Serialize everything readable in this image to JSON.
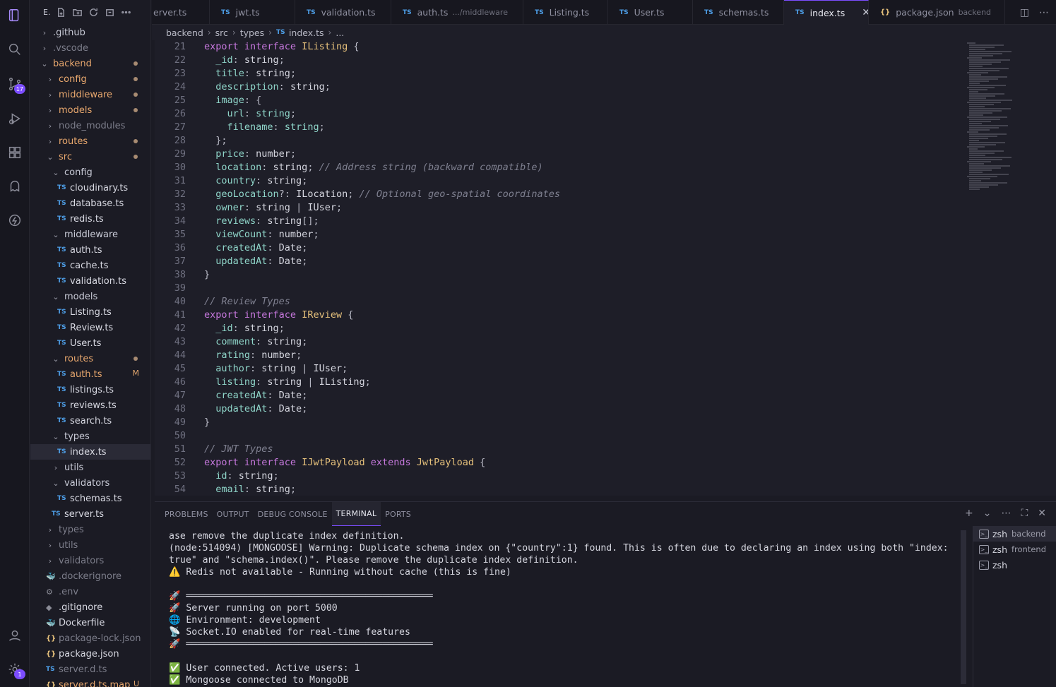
{
  "activity": {
    "source_control_badge": "17",
    "settings_badge": "1"
  },
  "sidebar": {
    "title": "E.",
    "tree": [
      {
        "label": ".github",
        "kind": "folder",
        "chev": "›",
        "indent": 0,
        "color": "folder"
      },
      {
        "label": ".vscode",
        "kind": "folder",
        "chev": "›",
        "indent": 0,
        "color": "dim"
      },
      {
        "label": "backend",
        "kind": "folder",
        "chev": "⌄",
        "indent": 0,
        "color": "orange",
        "dot": true
      },
      {
        "label": "config",
        "kind": "folder",
        "chev": "›",
        "indent": 1,
        "color": "orange",
        "dot": true
      },
      {
        "label": "middleware",
        "kind": "folder",
        "chev": "›",
        "indent": 1,
        "color": "orange",
        "dot": true
      },
      {
        "label": "models",
        "kind": "folder",
        "chev": "›",
        "indent": 1,
        "color": "orange",
        "dot": true
      },
      {
        "label": "node_modules",
        "kind": "folder",
        "chev": "›",
        "indent": 1,
        "color": "dim"
      },
      {
        "label": "routes",
        "kind": "folder",
        "chev": "›",
        "indent": 1,
        "color": "orange",
        "dot": true
      },
      {
        "label": "src",
        "kind": "folder",
        "chev": "⌄",
        "indent": 1,
        "color": "orange",
        "dot": true
      },
      {
        "label": "config",
        "kind": "folder",
        "chev": "⌄",
        "indent": 2,
        "color": "folder"
      },
      {
        "label": "cloudinary.ts",
        "kind": "ts",
        "indent": 3,
        "color": "file"
      },
      {
        "label": "database.ts",
        "kind": "ts",
        "indent": 3,
        "color": "file"
      },
      {
        "label": "redis.ts",
        "kind": "ts",
        "indent": 3,
        "color": "file"
      },
      {
        "label": "middleware",
        "kind": "folder",
        "chev": "⌄",
        "indent": 2,
        "color": "folder"
      },
      {
        "label": "auth.ts",
        "kind": "ts",
        "indent": 3,
        "color": "file"
      },
      {
        "label": "cache.ts",
        "kind": "ts",
        "indent": 3,
        "color": "file"
      },
      {
        "label": "validation.ts",
        "kind": "ts",
        "indent": 3,
        "color": "file"
      },
      {
        "label": "models",
        "kind": "folder",
        "chev": "⌄",
        "indent": 2,
        "color": "folder"
      },
      {
        "label": "Listing.ts",
        "kind": "ts",
        "indent": 3,
        "color": "file"
      },
      {
        "label": "Review.ts",
        "kind": "ts",
        "indent": 3,
        "color": "file"
      },
      {
        "label": "User.ts",
        "kind": "ts",
        "indent": 3,
        "color": "file"
      },
      {
        "label": "routes",
        "kind": "folder",
        "chev": "⌄",
        "indent": 2,
        "color": "orange",
        "dot": true
      },
      {
        "label": "auth.ts",
        "kind": "ts",
        "indent": 3,
        "color": "orange",
        "mod": "M"
      },
      {
        "label": "listings.ts",
        "kind": "ts",
        "indent": 3,
        "color": "file"
      },
      {
        "label": "reviews.ts",
        "kind": "ts",
        "indent": 3,
        "color": "file"
      },
      {
        "label": "search.ts",
        "kind": "ts",
        "indent": 3,
        "color": "file"
      },
      {
        "label": "types",
        "kind": "folder",
        "chev": "⌄",
        "indent": 2,
        "color": "folder"
      },
      {
        "label": "index.ts",
        "kind": "ts",
        "indent": 3,
        "color": "file",
        "selected": true
      },
      {
        "label": "utils",
        "kind": "folder",
        "chev": "›",
        "indent": 2,
        "color": "folder"
      },
      {
        "label": "validators",
        "kind": "folder",
        "chev": "⌄",
        "indent": 2,
        "color": "folder"
      },
      {
        "label": "schemas.ts",
        "kind": "ts",
        "indent": 3,
        "color": "file"
      },
      {
        "label": "server.ts",
        "kind": "ts",
        "indent": 2,
        "color": "file"
      },
      {
        "label": "types",
        "kind": "folder",
        "chev": "›",
        "indent": 1,
        "color": "dim"
      },
      {
        "label": "utils",
        "kind": "folder",
        "chev": "›",
        "indent": 1,
        "color": "dim"
      },
      {
        "label": "validators",
        "kind": "folder",
        "chev": "›",
        "indent": 1,
        "color": "dim"
      },
      {
        "label": ".dockerignore",
        "kind": "docker",
        "indent": 1,
        "color": "dim"
      },
      {
        "label": ".env",
        "kind": "gear",
        "indent": 1,
        "color": "dim"
      },
      {
        "label": ".gitignore",
        "kind": "misc",
        "indent": 1,
        "color": "file"
      },
      {
        "label": "Dockerfile",
        "kind": "docker",
        "indent": 1,
        "color": "file"
      },
      {
        "label": "package-lock.json",
        "kind": "json",
        "indent": 1,
        "color": "dim"
      },
      {
        "label": "package.json",
        "kind": "json",
        "indent": 1,
        "color": "file"
      },
      {
        "label": "server.d.ts",
        "kind": "ts",
        "indent": 1,
        "color": "dim"
      },
      {
        "label": "server.d.ts.map",
        "kind": "json",
        "indent": 1,
        "color": "orange",
        "mod": "U"
      }
    ]
  },
  "tabs": [
    {
      "label": "erver.ts",
      "icon": "none"
    },
    {
      "label": "jwt.ts",
      "icon": "ts"
    },
    {
      "label": "validation.ts",
      "icon": "ts"
    },
    {
      "label": "auth.ts",
      "icon": "ts",
      "desc": ".../middleware"
    },
    {
      "label": "Listing.ts",
      "icon": "ts"
    },
    {
      "label": "User.ts",
      "icon": "ts"
    },
    {
      "label": "schemas.ts",
      "icon": "ts"
    },
    {
      "label": "index.ts",
      "icon": "ts",
      "active": true
    },
    {
      "label": "package.json",
      "icon": "json",
      "desc": "backend"
    }
  ],
  "breadcrumb": {
    "seg1": "backend",
    "seg2": "src",
    "seg3": "types",
    "seg4": "index.ts",
    "seg5": "..."
  },
  "editor": {
    "lines": [
      {
        "n": "21",
        "tokens": [
          [
            "k",
            "export "
          ],
          [
            "k",
            "interface "
          ],
          [
            "t",
            "IListing "
          ],
          [
            "pu",
            "{"
          ]
        ]
      },
      {
        "n": "22",
        "tokens": [
          [
            "p",
            "  _id"
          ],
          [
            "pu",
            ": "
          ],
          [
            "ty",
            "string"
          ],
          [
            "pu",
            ";"
          ]
        ]
      },
      {
        "n": "23",
        "tokens": [
          [
            "p",
            "  title"
          ],
          [
            "pu",
            ": "
          ],
          [
            "ty",
            "string"
          ],
          [
            "pu",
            ";"
          ]
        ]
      },
      {
        "n": "24",
        "tokens": [
          [
            "p",
            "  description"
          ],
          [
            "pu",
            ": "
          ],
          [
            "ty",
            "string"
          ],
          [
            "pu",
            ";"
          ]
        ]
      },
      {
        "n": "25",
        "tokens": [
          [
            "p",
            "  image"
          ],
          [
            "pu",
            ": {"
          ]
        ]
      },
      {
        "n": "26",
        "tokens": [
          [
            "p",
            "    url"
          ],
          [
            "pu",
            ": "
          ],
          [
            "p",
            "string"
          ],
          [
            "pu",
            ";"
          ]
        ]
      },
      {
        "n": "27",
        "tokens": [
          [
            "p",
            "    filename"
          ],
          [
            "pu",
            ": "
          ],
          [
            "p",
            "string"
          ],
          [
            "pu",
            ";"
          ]
        ]
      },
      {
        "n": "28",
        "tokens": [
          [
            "pu",
            "  };"
          ]
        ]
      },
      {
        "n": "29",
        "tokens": [
          [
            "p",
            "  price"
          ],
          [
            "pu",
            ": "
          ],
          [
            "ty",
            "number"
          ],
          [
            "pu",
            ";"
          ]
        ]
      },
      {
        "n": "30",
        "tokens": [
          [
            "p",
            "  location"
          ],
          [
            "pu",
            ": "
          ],
          [
            "ty",
            "string"
          ],
          [
            "pu",
            "; "
          ],
          [
            "cm",
            "// Address string (backward compatible)"
          ]
        ]
      },
      {
        "n": "31",
        "tokens": [
          [
            "p",
            "  country"
          ],
          [
            "pu",
            ": "
          ],
          [
            "ty",
            "string"
          ],
          [
            "pu",
            ";"
          ]
        ]
      },
      {
        "n": "32",
        "tokens": [
          [
            "p",
            "  geoLocation"
          ],
          [
            "pu",
            "?: "
          ],
          [
            "ty",
            "ILocation"
          ],
          [
            "pu",
            "; "
          ],
          [
            "cm",
            "// Optional geo-spatial coordinates"
          ]
        ]
      },
      {
        "n": "33",
        "tokens": [
          [
            "p",
            "  owner"
          ],
          [
            "pu",
            ": "
          ],
          [
            "ty",
            "string "
          ],
          [
            "pu",
            "| "
          ],
          [
            "ty",
            "IUser"
          ],
          [
            "pu",
            ";"
          ]
        ]
      },
      {
        "n": "34",
        "tokens": [
          [
            "p",
            "  reviews"
          ],
          [
            "pu",
            ": "
          ],
          [
            "ty",
            "string"
          ],
          [
            "pu",
            "[];"
          ]
        ]
      },
      {
        "n": "35",
        "tokens": [
          [
            "p",
            "  viewCount"
          ],
          [
            "pu",
            ": "
          ],
          [
            "ty",
            "number"
          ],
          [
            "pu",
            ";"
          ]
        ]
      },
      {
        "n": "36",
        "tokens": [
          [
            "p",
            "  createdAt"
          ],
          [
            "pu",
            ": "
          ],
          [
            "ty",
            "Date"
          ],
          [
            "pu",
            ";"
          ]
        ]
      },
      {
        "n": "37",
        "tokens": [
          [
            "p",
            "  updatedAt"
          ],
          [
            "pu",
            ": "
          ],
          [
            "ty",
            "Date"
          ],
          [
            "pu",
            ";"
          ]
        ]
      },
      {
        "n": "38",
        "tokens": [
          [
            "pu",
            "}"
          ]
        ]
      },
      {
        "n": "39",
        "tokens": []
      },
      {
        "n": "40",
        "tokens": [
          [
            "cm",
            "// Review Types"
          ]
        ]
      },
      {
        "n": "41",
        "tokens": [
          [
            "k",
            "export "
          ],
          [
            "k",
            "interface "
          ],
          [
            "t",
            "IReview "
          ],
          [
            "pu",
            "{"
          ]
        ]
      },
      {
        "n": "42",
        "tokens": [
          [
            "p",
            "  _id"
          ],
          [
            "pu",
            ": "
          ],
          [
            "ty",
            "string"
          ],
          [
            "pu",
            ";"
          ]
        ]
      },
      {
        "n": "43",
        "tokens": [
          [
            "p",
            "  comment"
          ],
          [
            "pu",
            ": "
          ],
          [
            "ty",
            "string"
          ],
          [
            "pu",
            ";"
          ]
        ]
      },
      {
        "n": "44",
        "tokens": [
          [
            "p",
            "  rating"
          ],
          [
            "pu",
            ": "
          ],
          [
            "ty",
            "number"
          ],
          [
            "pu",
            ";"
          ]
        ]
      },
      {
        "n": "45",
        "tokens": [
          [
            "p",
            "  author"
          ],
          [
            "pu",
            ": "
          ],
          [
            "ty",
            "string "
          ],
          [
            "pu",
            "| "
          ],
          [
            "ty",
            "IUser"
          ],
          [
            "pu",
            ";"
          ]
        ]
      },
      {
        "n": "46",
        "tokens": [
          [
            "p",
            "  listing"
          ],
          [
            "pu",
            ": "
          ],
          [
            "ty",
            "string "
          ],
          [
            "pu",
            "| "
          ],
          [
            "ty",
            "IListing"
          ],
          [
            "pu",
            ";"
          ]
        ]
      },
      {
        "n": "47",
        "tokens": [
          [
            "p",
            "  createdAt"
          ],
          [
            "pu",
            ": "
          ],
          [
            "ty",
            "Date"
          ],
          [
            "pu",
            ";"
          ]
        ]
      },
      {
        "n": "48",
        "tokens": [
          [
            "p",
            "  updatedAt"
          ],
          [
            "pu",
            ": "
          ],
          [
            "ty",
            "Date"
          ],
          [
            "pu",
            ";"
          ]
        ]
      },
      {
        "n": "49",
        "tokens": [
          [
            "pu",
            "}"
          ]
        ]
      },
      {
        "n": "50",
        "tokens": []
      },
      {
        "n": "51",
        "tokens": [
          [
            "cm",
            "// JWT Types"
          ]
        ]
      },
      {
        "n": "52",
        "tokens": [
          [
            "k",
            "export "
          ],
          [
            "k",
            "interface "
          ],
          [
            "t",
            "IJwtPayload "
          ],
          [
            "k",
            "extends "
          ],
          [
            "t",
            "JwtPayload "
          ],
          [
            "pu",
            "{"
          ]
        ]
      },
      {
        "n": "53",
        "tokens": [
          [
            "p",
            "  id"
          ],
          [
            "pu",
            ": "
          ],
          [
            "ty",
            "string"
          ],
          [
            "pu",
            ";"
          ]
        ]
      },
      {
        "n": "54",
        "tokens": [
          [
            "p",
            "  email"
          ],
          [
            "pu",
            ": "
          ],
          [
            "ty",
            "string"
          ],
          [
            "pu",
            ";"
          ]
        ]
      }
    ]
  },
  "panel": {
    "tabs": [
      "PROBLEMS",
      "OUTPUT",
      "DEBUG CONSOLE",
      "TERMINAL",
      "PORTS"
    ],
    "active_tab": "TERMINAL",
    "terminal_lines": [
      "ase remove the duplicate index definition.",
      "(node:514094) [MONGOOSE] Warning: Duplicate schema index on {\"country\":1} found. This is often due to declaring an index using both \"index:",
      "true\" and \"schema.index()\". Please remove the duplicate index definition.",
      "⚠️ Redis not available - Running without cache (this is fine)",
      "",
      "🚀 ════════════════════════════════════════════",
      "🚀 Server running on port 5000",
      "🌐 Environment: development",
      "📡 Socket.IO enabled for real-time features",
      "🚀 ════════════════════════════════════════════",
      "",
      "✅ User connected. Active users: 1",
      "✅ Mongoose connected to MongoDB"
    ],
    "terminals": [
      {
        "name": "zsh",
        "desc": "backend",
        "active": true
      },
      {
        "name": "zsh",
        "desc": "frontend"
      },
      {
        "name": "zsh",
        "desc": ""
      }
    ]
  }
}
